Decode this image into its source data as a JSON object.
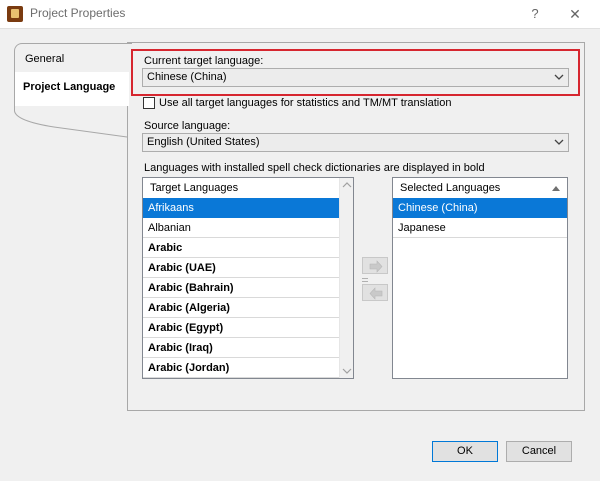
{
  "window": {
    "title": "Project Properties",
    "help_glyph": "?",
    "close_glyph": "✕"
  },
  "nav": {
    "tabs": [
      {
        "label": "General"
      },
      {
        "label": "Project Language",
        "selected": true
      }
    ]
  },
  "current_target": {
    "label": "Current target language:",
    "value": "Chinese (China)"
  },
  "use_all": {
    "label": "Use all target languages for statistics and TM/MT translation",
    "checked": false
  },
  "source": {
    "label": "Source language:",
    "value": "English (United States)"
  },
  "spell_note": "Languages with installed spell check dictionaries are displayed in bold",
  "target_list": {
    "header": "Target Languages",
    "items": [
      {
        "label": "Afrikaans",
        "bold": false,
        "selected": true
      },
      {
        "label": "Albanian",
        "bold": false
      },
      {
        "label": "Arabic",
        "bold": true
      },
      {
        "label": "Arabic (UAE)",
        "bold": true
      },
      {
        "label": "Arabic (Bahrain)",
        "bold": true
      },
      {
        "label": "Arabic (Algeria)",
        "bold": true
      },
      {
        "label": "Arabic (Egypt)",
        "bold": true
      },
      {
        "label": "Arabic (Iraq)",
        "bold": true
      },
      {
        "label": "Arabic (Jordan)",
        "bold": true
      }
    ]
  },
  "selected_list": {
    "header": "Selected Languages",
    "items": [
      {
        "label": "Chinese (China)",
        "selected": true
      },
      {
        "label": "Japanese"
      }
    ]
  },
  "buttons": {
    "ok": "OK",
    "cancel": "Cancel"
  },
  "colors": {
    "highlight_border": "#d6262f",
    "selection": "#0a78d7"
  }
}
